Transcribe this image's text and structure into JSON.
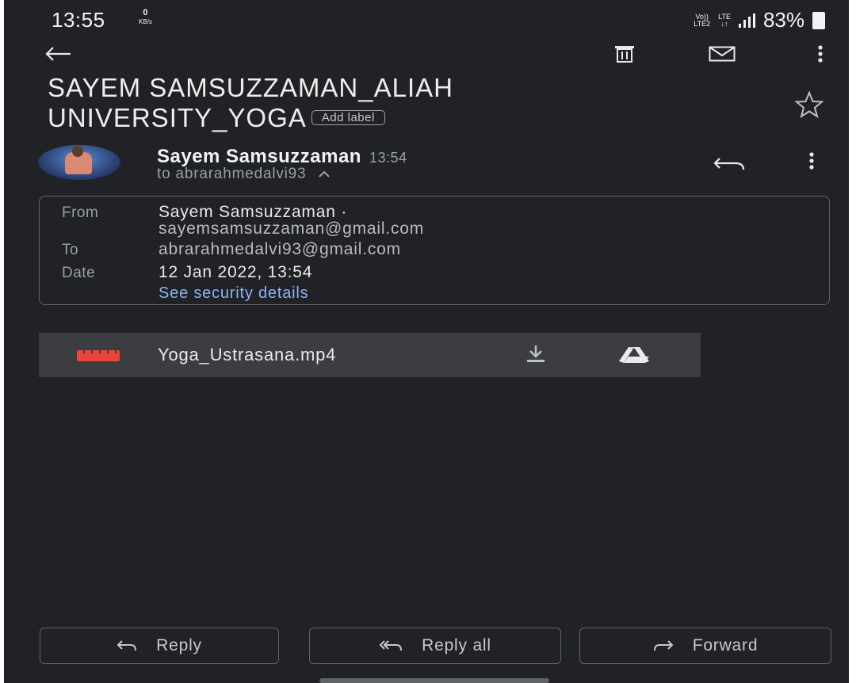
{
  "status_bar": {
    "time": "13:55",
    "net_speed_value": "0",
    "net_speed_unit": "KB/s",
    "volte_top": "Vo))",
    "volte_bottom": "LTE2",
    "lte_label": "LTE",
    "battery": "83%"
  },
  "subject": {
    "line1": "SAYEM SAMSUZZAMAN_ALIAH",
    "line2": "UNIVERSITY_YOGA",
    "label_chip": "Add label"
  },
  "sender": {
    "name": "Sayem Samsuzzaman",
    "time": "13:54",
    "to": "to abrarahmedalvi93"
  },
  "details": {
    "from_key": "From",
    "from_name": "Sayem Samsuzzaman ·",
    "from_email": "sayemsamsuzzaman@gmail.com",
    "to_key": "To",
    "to_value": "abrarahmedalvi93@gmail.com",
    "date_key": "Date",
    "date_value": "12 Jan 2022, 13:54",
    "security_link": "See security details"
  },
  "attachment": {
    "filename": "Yoga_Ustrasana.mp4",
    "type_icon": "video-file-icon",
    "actions": [
      "download-icon",
      "drive-icon"
    ]
  },
  "actions": {
    "reply": "Reply",
    "reply_all": "Reply all",
    "forward": "Forward"
  },
  "colors": {
    "background": "#212225",
    "link": "#8ab4f8",
    "video_icon": "#e8453c",
    "attachment_bg": "#3c3d40"
  }
}
